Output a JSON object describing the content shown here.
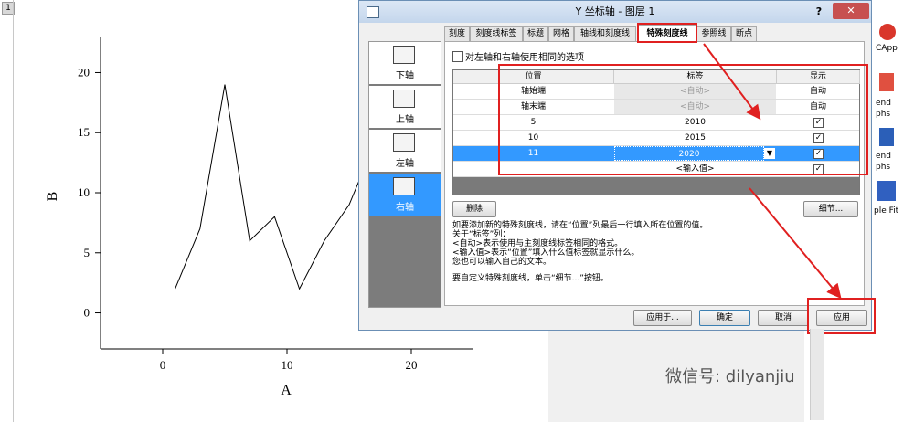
{
  "graph": {
    "window_number": "1",
    "xlabel": "A",
    "ylabel": "B",
    "xticks": [
      "0",
      "10",
      "20"
    ],
    "yticks": [
      "0",
      "5",
      "10",
      "15",
      "20"
    ],
    "series_x": [
      1,
      3,
      5,
      7,
      9,
      11,
      13,
      15,
      16
    ],
    "series_y": [
      2,
      7,
      19,
      6,
      8,
      2,
      6,
      9,
      11.5
    ],
    "xlim": [
      -5,
      25
    ],
    "ylim": [
      -3,
      23
    ]
  },
  "dialog": {
    "title": "Y 坐标轴 - 图层 1",
    "help": "?",
    "close": "✕",
    "tabs": [
      "刻度",
      "刻度线标签",
      "标题",
      "网格",
      "轴线和刻度线",
      "特殊刻度线",
      "参照线",
      "断点"
    ],
    "active_tab": "特殊刻度线",
    "nav": [
      "下轴",
      "上轴",
      "左轴",
      "右轴"
    ],
    "selected_nav": "右轴",
    "same_options_label": "对左轴和右轴使用相同的选项",
    "grid": {
      "headers": [
        "位置",
        "标签",
        "显示"
      ],
      "rows": [
        {
          "pos": "轴始端",
          "label": "<自动>",
          "show": "自动"
        },
        {
          "pos": "轴末端",
          "label": "<自动>",
          "show": "自动"
        },
        {
          "pos": "5",
          "label": "2010",
          "show": "✓"
        },
        {
          "pos": "10",
          "label": "2015",
          "show": "✓"
        },
        {
          "pos": "11",
          "label": "2020",
          "show": "✓"
        },
        {
          "pos": "",
          "label": "<输入值>",
          "show": "✓"
        }
      ]
    },
    "delete_btn": "删除",
    "detail_btn": "细节...",
    "help_text": [
      "如要添加新的特殊刻度线，请在“位置”列最后一行填入所在位置的值。",
      "关于“标签”列：",
      "<自动>表示使用与主刻度线标签相同的格式。",
      "<输入值>表示“位置”填入什么值标签就显示什么。",
      "您也可以输入自己的文本。",
      "要自定义特殊刻度线，单击“细节...”按钮。"
    ],
    "apply_to_btn": "应用于...",
    "ok_btn": "确定",
    "cancel_btn": "取消",
    "apply_btn": "应用"
  },
  "right_strip": {
    "items": [
      "CApp",
      "end",
      "phs",
      "end",
      "phs",
      "ple Fit"
    ]
  },
  "watermark": "微信号: dilyanjiu",
  "colors": {
    "highlight_red": "#e02020",
    "selection_blue": "#3399ff"
  }
}
